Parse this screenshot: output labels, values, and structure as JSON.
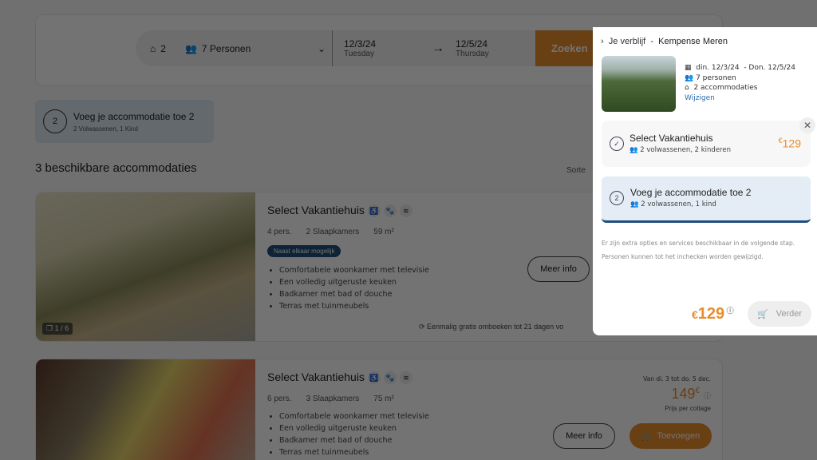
{
  "search": {
    "houses": "2",
    "persons": "7 Personen",
    "date_from": "12/3/24",
    "day_from": "Tuesday",
    "date_to": "12/5/24",
    "day_to": "Thursday",
    "search_label": "Zoeken"
  },
  "add_accommodation": {
    "title": "Voeg je accommodatie toe 2",
    "subtitle": "2 Volwassenen, 1 Kind",
    "number": "2"
  },
  "results": {
    "heading": "3 beschikbare accommodaties",
    "sort_label": "Sorte"
  },
  "accommodations": [
    {
      "title": "Select Vakantiehuis",
      "persons": "4 pers.",
      "bedrooms": "2 Slaapkamers",
      "area": "59 m²",
      "badge": "Naast elkaar mogelijk",
      "features": [
        "Comfortabele woonkamer met televisie",
        "Een volledig uitgeruste keuken",
        "Badkamer met bad of douche",
        "Terras met tuinmeubels"
      ],
      "photo_counter": "1 / 6",
      "more_info": "Meer info",
      "rebook": "Eenmalig gratis omboeken tot 21 dagen vo"
    },
    {
      "title": "Select Vakantiehuis",
      "persons": "6 pers.",
      "bedrooms": "3 Slaapkamers",
      "area": "75 m²",
      "features": [
        "Comfortabele woonkamer met televisie",
        "Een volledig uitgeruste keuken",
        "Badkamer met bad of douche",
        "Terras met tuinmeubels"
      ],
      "period": "Van di. 3 tot do. 5 dec.",
      "price": "149",
      "currency": "€",
      "price_note": "Prijs per cottage",
      "more_info": "Meer info",
      "add_label": "Toevoegen"
    }
  ],
  "panel": {
    "header_prefix": "Je verblijf",
    "separator": "-",
    "park": "Kempense Meren",
    "dates_from": "din. 12/3/24",
    "dates_to": "- Don. 12/5/24",
    "persons": "7 personen",
    "accommodations": "2 accommodaties",
    "change": "Wijzigen",
    "selected": {
      "title": "Select Vakantiehuis",
      "guests": "2 volwassenen, 2 kinderen",
      "currency": "€",
      "price": "129"
    },
    "add_next": {
      "title": "Voeg je accommodatie toe 2",
      "guests": "2 volwassenen, 1 kind",
      "number": "2"
    },
    "note1": "Er zijn extra opties en services beschikbaar in de volgende stap.",
    "note2": "Personen kunnen tot het inchecken worden gewijzigd.",
    "total_currency": "€",
    "total": "129",
    "continue": "Verder"
  },
  "colors": {
    "accent": "#e98d2c",
    "navy": "#1f4e79",
    "link": "#2a6aa8"
  }
}
